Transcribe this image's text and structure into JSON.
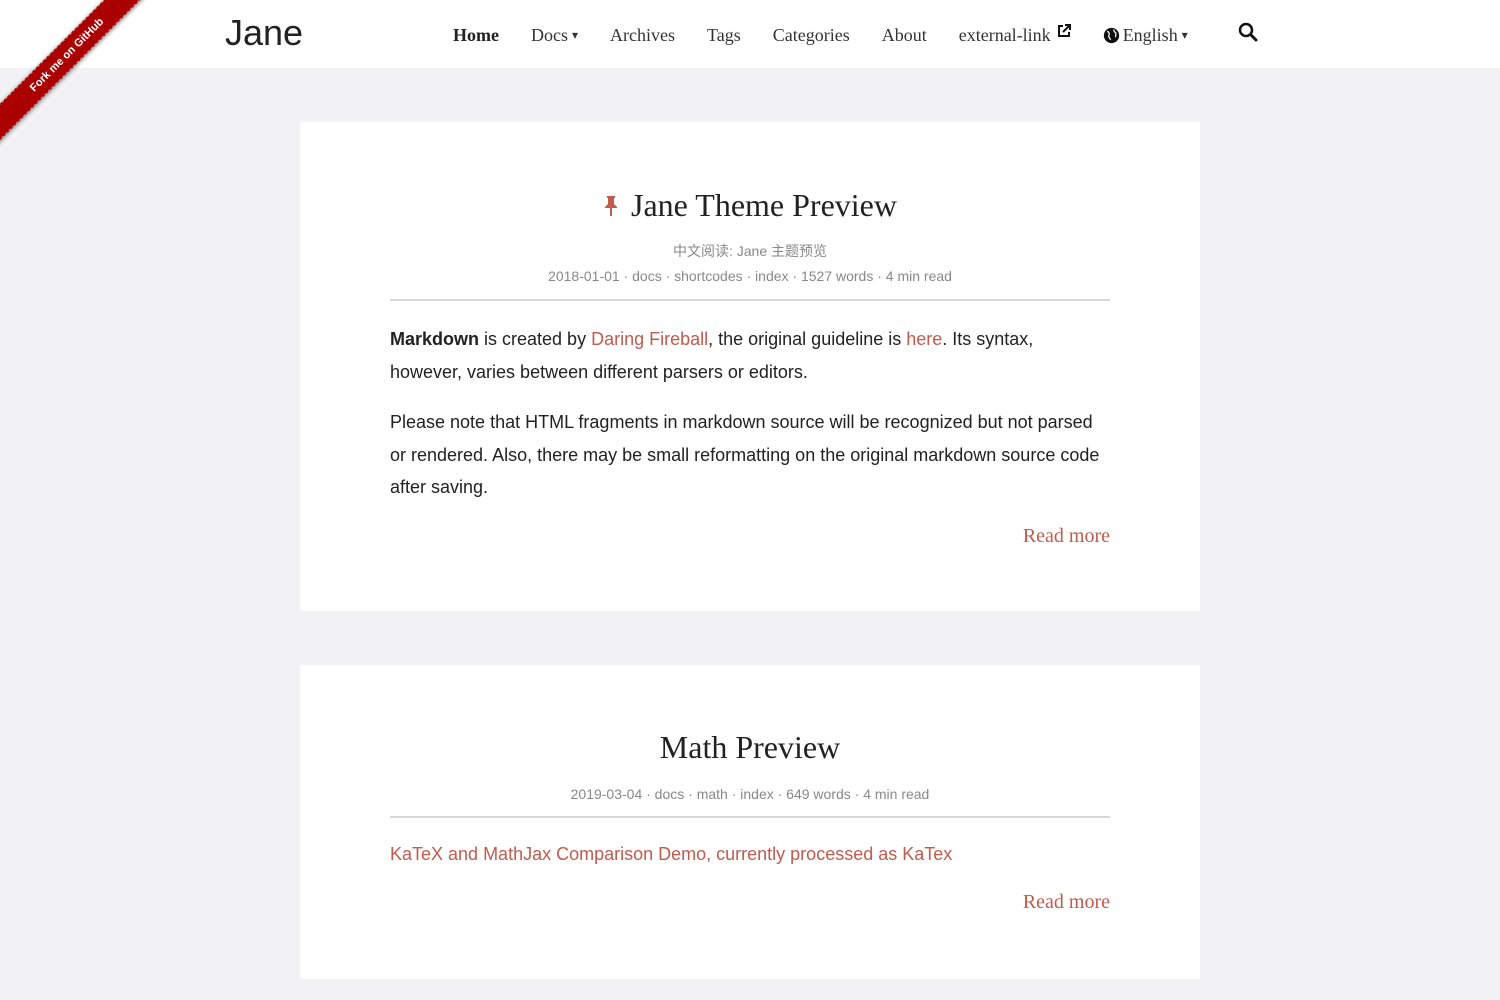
{
  "site": {
    "logo": "Jane"
  },
  "ribbon": {
    "text": "Fork me on GitHub"
  },
  "nav": {
    "home": "Home",
    "docs": "Docs",
    "docs_caret": "▾",
    "archives": "Archives",
    "tags": "Tags",
    "categories": "Categories",
    "about": "About",
    "external": "external-link",
    "language": "English",
    "language_caret": "▾"
  },
  "posts": [
    {
      "title": "Jane Theme Preview",
      "pinned": true,
      "subtitle": "中文阅读: Jane 主题预览",
      "meta": "2018-01-01 · docs · shortcodes · index · 1527 words · 4 min read",
      "p1": {
        "bold": "Markdown",
        "t1": " is created by ",
        "link1": "Daring Fireball",
        "t2": ", the original guideline is ",
        "link2": "here",
        "t3": ". Its syntax, however, varies between different parsers or editors."
      },
      "p2": "Please note that HTML fragments in markdown source will be recognized but not parsed or rendered. Also, there may be small reformatting on the original markdown source code after saving.",
      "read_more": "Read more"
    },
    {
      "title": "Math Preview",
      "pinned": false,
      "meta": "2019-03-04 · docs · math · index · 649 words · 4 min read",
      "summary_link": "KaTeX and MathJax Comparison Demo, currently processed as KaTex",
      "read_more": "Read more"
    }
  ],
  "colors": {
    "accent": "#c05b4d",
    "ribbon": "#aa0000",
    "background": "#f2f2f4"
  }
}
